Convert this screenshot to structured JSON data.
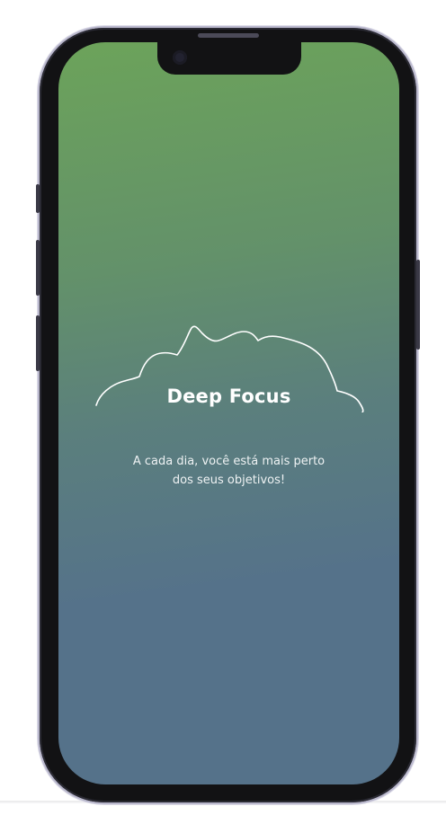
{
  "app": {
    "title": "Deep Focus",
    "tagline_line1": "A cada dia, você está mais perto",
    "tagline_line2": "dos seus objetivos!"
  },
  "colors": {
    "gradient_top": "#6ca35a",
    "gradient_bottom": "#55728a",
    "text": "#ffffff",
    "frame": "#121214"
  },
  "icons": {
    "cloud": "cloud-outline-icon"
  }
}
